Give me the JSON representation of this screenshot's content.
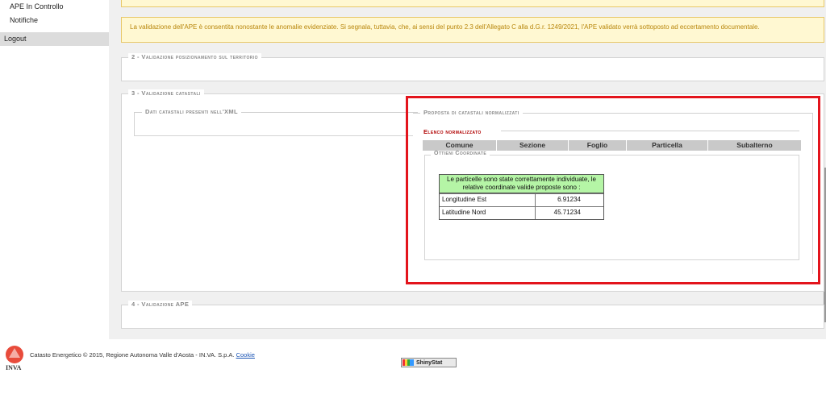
{
  "sidebar": {
    "items": [
      {
        "label": "APE In Controllo"
      },
      {
        "label": "Notifiche"
      }
    ],
    "logout": "Logout"
  },
  "alert": {
    "text": "La validazione dell'APE è consentita nonostante le anomalie evidenziate. Si segnala, tuttavia, che, ai sensi del punto 2.3 dell'Allegato C alla d.G.r. 1249/2021, l'APE validato verrà sottoposto ad eccertamento documentale."
  },
  "sections": {
    "s2": "2 - Validazione posizionamento sul territorio",
    "s3": "3 - Validazione catastali",
    "s3_left": "Dati catastali presenti nell'XML",
    "s3_right": "Proposta di catastali normalizzati",
    "s4": "4 - Validazione APE"
  },
  "elenco": {
    "title": "Elenco normalizzato",
    "columns": [
      "Comune",
      "Sezione",
      "Foglio",
      "Particella",
      "Subalterno"
    ]
  },
  "coordinate": {
    "legend": "Ottieni Coordinate",
    "message": "Le particelle sono state correttamente individuate, le relative coordinate valide proposte sono :",
    "rows": [
      {
        "label": "Longitudine Est",
        "value": "6.91234"
      },
      {
        "label": "Latitudine Nord",
        "value": "45.71234"
      }
    ]
  },
  "footer": {
    "logo_text": "INVA",
    "text": "Catasto Energetico © 2015, Regione Autonoma Valle d'Aosta - IN.VA. S.p.A.",
    "cookie_link": "Cookie",
    "badge": "ShinyStat"
  },
  "colors": {
    "highlight_border": "#e3141c",
    "alert_background": "#fff8d2",
    "alert_text": "#b8860b",
    "message_background": "#b5f5a6",
    "section_title": "#b00000"
  }
}
